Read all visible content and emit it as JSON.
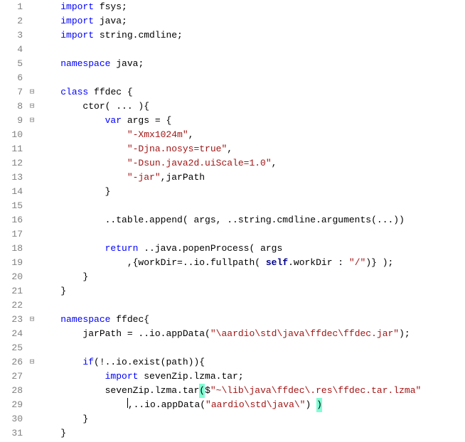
{
  "lines": [
    {
      "n": 1,
      "fold": "",
      "ind": "    ",
      "code": [
        {
          "t": "import",
          "c": "kw"
        },
        {
          "t": " fsys;",
          "c": ""
        }
      ]
    },
    {
      "n": 2,
      "fold": "",
      "ind": "    ",
      "code": [
        {
          "t": "import",
          "c": "kw"
        },
        {
          "t": " java;",
          "c": ""
        }
      ]
    },
    {
      "n": 3,
      "fold": "",
      "ind": "    ",
      "code": [
        {
          "t": "import",
          "c": "kw"
        },
        {
          "t": " string.cmdline;",
          "c": ""
        }
      ]
    },
    {
      "n": 4,
      "fold": "",
      "ind": "",
      "code": [
        {
          "t": "",
          "c": ""
        }
      ]
    },
    {
      "n": 5,
      "fold": "",
      "ind": "    ",
      "code": [
        {
          "t": "namespace",
          "c": "kw"
        },
        {
          "t": " java;",
          "c": ""
        }
      ]
    },
    {
      "n": 6,
      "fold": "",
      "ind": "",
      "code": [
        {
          "t": "",
          "c": ""
        }
      ]
    },
    {
      "n": 7,
      "fold": "⊟",
      "ind": "    ",
      "code": [
        {
          "t": "class",
          "c": "kw"
        },
        {
          "t": " ffdec {",
          "c": ""
        }
      ]
    },
    {
      "n": 8,
      "fold": "⊟",
      "ind": "        ",
      "code": [
        {
          "t": "ctor( ... ){",
          "c": ""
        }
      ]
    },
    {
      "n": 9,
      "fold": "⊟",
      "ind": "            ",
      "code": [
        {
          "t": "var",
          "c": "kw"
        },
        {
          "t": " args = {",
          "c": ""
        }
      ]
    },
    {
      "n": 10,
      "fold": "",
      "ind": "                ",
      "code": [
        {
          "t": "\"-Xmx1024m\"",
          "c": "str"
        },
        {
          "t": ",",
          "c": ""
        }
      ]
    },
    {
      "n": 11,
      "fold": "",
      "ind": "                ",
      "code": [
        {
          "t": "\"-Djna.nosys=true\"",
          "c": "str"
        },
        {
          "t": ",",
          "c": ""
        }
      ]
    },
    {
      "n": 12,
      "fold": "",
      "ind": "                ",
      "code": [
        {
          "t": "\"-Dsun.java2d.uiScale=1.0\"",
          "c": "str"
        },
        {
          "t": ",",
          "c": ""
        }
      ]
    },
    {
      "n": 13,
      "fold": "",
      "ind": "                ",
      "code": [
        {
          "t": "\"-jar\"",
          "c": "str"
        },
        {
          "t": ",jarPath",
          "c": ""
        }
      ]
    },
    {
      "n": 14,
      "fold": "",
      "ind": "            ",
      "code": [
        {
          "t": "}",
          "c": ""
        }
      ]
    },
    {
      "n": 15,
      "fold": "",
      "ind": "",
      "code": [
        {
          "t": "",
          "c": ""
        }
      ]
    },
    {
      "n": 16,
      "fold": "",
      "ind": "            ",
      "code": [
        {
          "t": "..table.append( args, ..string.cmdline.arguments(...))",
          "c": ""
        }
      ]
    },
    {
      "n": 17,
      "fold": "",
      "ind": "",
      "code": [
        {
          "t": "",
          "c": ""
        }
      ]
    },
    {
      "n": 18,
      "fold": "",
      "ind": "            ",
      "code": [
        {
          "t": "return",
          "c": "kw"
        },
        {
          "t": " ..java.popenProcess( args",
          "c": ""
        }
      ]
    },
    {
      "n": 19,
      "fold": "",
      "ind": "                ",
      "code": [
        {
          "t": ",{workDir=..io.fullpath( ",
          "c": ""
        },
        {
          "t": "self",
          "c": "self"
        },
        {
          "t": ".workDir : ",
          "c": ""
        },
        {
          "t": "\"/\"",
          "c": "str"
        },
        {
          "t": ")} );",
          "c": ""
        }
      ]
    },
    {
      "n": 20,
      "fold": "",
      "ind": "        ",
      "code": [
        {
          "t": "}",
          "c": ""
        }
      ]
    },
    {
      "n": 21,
      "fold": "",
      "ind": "    ",
      "code": [
        {
          "t": "}",
          "c": ""
        }
      ]
    },
    {
      "n": 22,
      "fold": "",
      "ind": "",
      "code": [
        {
          "t": "",
          "c": ""
        }
      ]
    },
    {
      "n": 23,
      "fold": "⊟",
      "ind": "    ",
      "code": [
        {
          "t": "namespace",
          "c": "kw"
        },
        {
          "t": " ffdec{",
          "c": ""
        }
      ]
    },
    {
      "n": 24,
      "fold": "",
      "ind": "        ",
      "code": [
        {
          "t": "jarPath = ..io.appData(",
          "c": ""
        },
        {
          "t": "\"\\aardio\\std\\java\\ffdec\\ffdec.jar\"",
          "c": "str"
        },
        {
          "t": ");",
          "c": ""
        }
      ]
    },
    {
      "n": 25,
      "fold": "",
      "ind": "",
      "code": [
        {
          "t": "",
          "c": ""
        }
      ]
    },
    {
      "n": 26,
      "fold": "⊟",
      "ind": "        ",
      "code": [
        {
          "t": "if",
          "c": "kw"
        },
        {
          "t": "(!..io.exist(path)){",
          "c": ""
        }
      ]
    },
    {
      "n": 27,
      "fold": "",
      "ind": "            ",
      "code": [
        {
          "t": "import",
          "c": "kw"
        },
        {
          "t": " sevenZip.lzma.tar;",
          "c": ""
        }
      ]
    },
    {
      "n": 28,
      "fold": "",
      "ind": "            ",
      "code": [
        {
          "t": "sevenZip.lzma.tar",
          "c": ""
        },
        {
          "t": "(",
          "c": "hl-open"
        },
        {
          "t": "$",
          "c": ""
        },
        {
          "t": "\"~\\lib\\java\\ffdec\\.res\\ffdec.tar.lzma\"",
          "c": "str"
        }
      ]
    },
    {
      "n": 29,
      "fold": "",
      "ind": "                ",
      "code": [
        {
          "t": "",
          "c": "caret-before"
        },
        {
          "t": ",..io.appData(",
          "c": ""
        },
        {
          "t": "\"aardio\\std\\java\\\"",
          "c": "str"
        },
        {
          "t": ") ",
          "c": ""
        },
        {
          "t": ")",
          "c": "hl-close"
        }
      ]
    },
    {
      "n": 30,
      "fold": "",
      "ind": "        ",
      "code": [
        {
          "t": "}",
          "c": ""
        }
      ]
    },
    {
      "n": 31,
      "fold": "",
      "ind": "    ",
      "code": [
        {
          "t": "}",
          "c": ""
        }
      ]
    }
  ]
}
